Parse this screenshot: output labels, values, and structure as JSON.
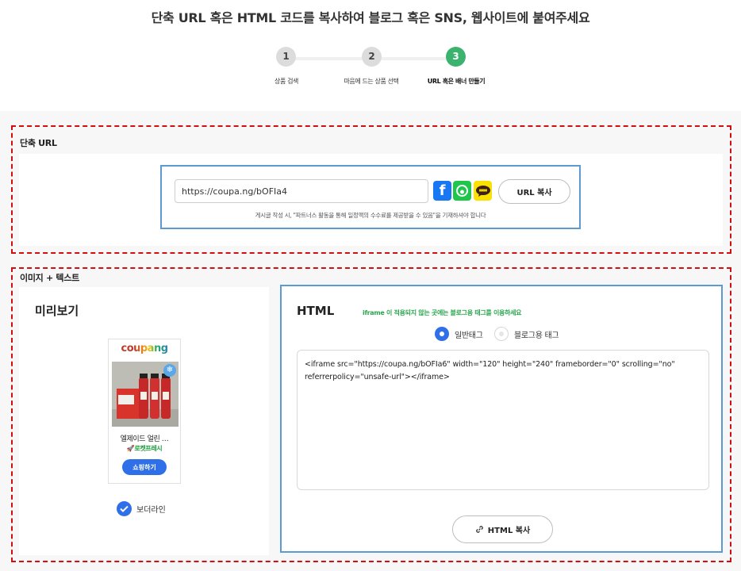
{
  "header": {
    "title": "단축 URL 혹은 HTML 코드를 복사하여 블로그 혹은 SNS, 웹사이트에 붙여주세요"
  },
  "steps": [
    {
      "number": "1",
      "label": "상품 검색",
      "active": false
    },
    {
      "number": "2",
      "label": "마음에 드는 상품 선택",
      "active": false
    },
    {
      "number": "3",
      "label": "URL 혹은 배너 만들기",
      "active": true
    }
  ],
  "short_url": {
    "section_title": "단축 URL",
    "url_value": "https://coupa.ng/bOFIa4",
    "facebook_glyph": "f",
    "copy_label": "URL 복사",
    "notice": "게시글 작성 시, \"파트너스 활동을 통해 일정액의 수수료를 제공받을 수 있음\"을 기재하셔야 합니다",
    "icons": [
      "facebook-icon",
      "band-icon",
      "kakaotalk-icon"
    ]
  },
  "image_text": {
    "section_title": "이미지 + 텍스트",
    "preview_title": "미리보기",
    "banner": {
      "logo": "coupang",
      "product_name": "엘제이드 얼린 …",
      "rocket_label": "로켓프레시",
      "shop_button": "쇼핑하기"
    },
    "border_label": "보더라인",
    "html_panel": {
      "title": "HTML",
      "tip": "iframe 이 적용되지 않는 곳에는 블로그용 태그를 이용하세요",
      "radio_general": "일반태그",
      "radio_blog": "블로그용 태그",
      "code": "<iframe src=\"https://coupa.ng/bOFIa6\" width=\"120\" height=\"240\" frameborder=\"0\" scrolling=\"no\" referrerpolicy=\"unsafe-url\"></iframe>",
      "copy_label": "HTML 복사"
    }
  },
  "colors": {
    "accent_green": "#3bb36e",
    "accent_blue": "#2f6fe8",
    "highlight_border": "#5c9bd1",
    "dashed_red": "#d01010"
  }
}
